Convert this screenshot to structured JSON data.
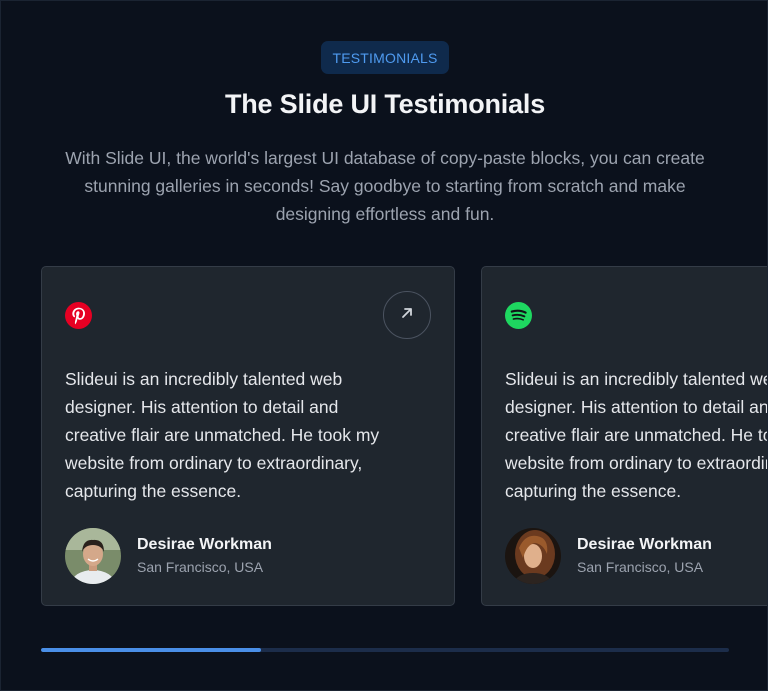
{
  "section": {
    "badge": "TESTIMONIALS",
    "title": "The Slide UI Testimonials",
    "subtitle": "With Slide UI, the world's largest UI database of copy-paste blocks, you can create stunning galleries in seconds! Say goodbye to starting from scratch and make designing effortless and fun."
  },
  "testimonials": [
    {
      "brand_icon": "pinterest-icon",
      "brand_color": "#e60023",
      "quote": "Slideui is an incredibly talented web\ndesigner. His attention to detail and\ncreative flair are unmatched. He took my\nwebsite from ordinary to extraordinary,\ncapturing the essence.",
      "name": "Desirae Workman",
      "location": "San Francisco, USA",
      "action_icon": "arrow-up-right-icon"
    },
    {
      "brand_icon": "spotify-icon",
      "brand_color": "#1ed760",
      "quote": "Slideui is an incredibly talented web\ndesigner. His attention to detail and\ncreative flair are unmatched. He took my\nwebsite from ordinary to extraordinary,\ncapturing the essence.",
      "name": "Desirae Workman",
      "location": "San Francisco, USA"
    }
  ],
  "carousel": {
    "progress_fraction": 0.32
  },
  "colors": {
    "background": "#0b111c",
    "card": "#1f262e",
    "accent": "#4a8fe7",
    "badge_bg": "#0f2a4c",
    "badge_text": "#4f9bf0"
  }
}
